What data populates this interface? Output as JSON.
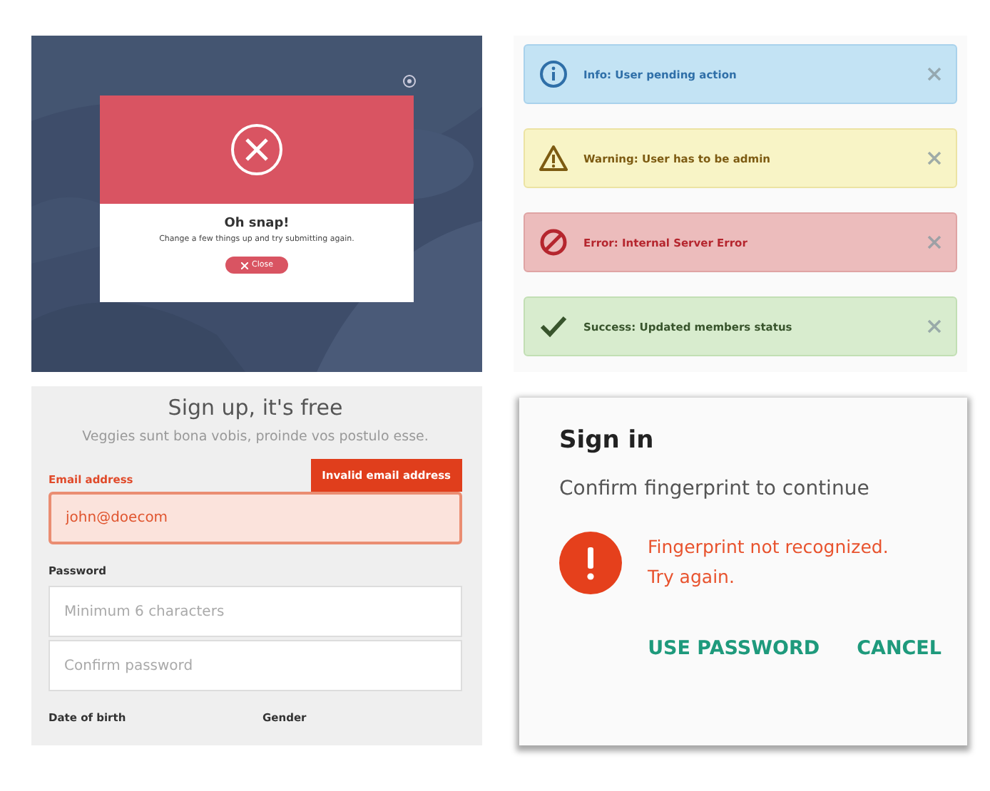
{
  "error_modal": {
    "title": "Oh snap!",
    "message": "Change a few things up and try submitting again.",
    "button": "Close"
  },
  "alerts": [
    {
      "kind": "info",
      "text": "Info: User pending action"
    },
    {
      "kind": "warning",
      "text": "Warning: User has to be admin"
    },
    {
      "kind": "error",
      "text": "Error: Internal Server Error"
    },
    {
      "kind": "success",
      "text": "Success: Updated members status"
    }
  ],
  "signup": {
    "title": "Sign up, it's free",
    "subtitle": "Veggies sunt bona vobis, proinde vos postulo esse.",
    "email": {
      "label": "Email address",
      "error": "Invalid email address",
      "value": "john@doecom",
      "invalid": true
    },
    "password": {
      "label": "Password",
      "placeholder": "Minimum 6 characters"
    },
    "confirm": {
      "placeholder": "Confirm password"
    },
    "bottom_labels": [
      "Date of birth",
      "Gender"
    ]
  },
  "signin": {
    "title": "Sign in",
    "message": "Confirm fingerprint to continue",
    "error": "Fingerprint not recognized. Try again.",
    "buttons": [
      "USE PASSWORD",
      "CANCEL"
    ]
  }
}
